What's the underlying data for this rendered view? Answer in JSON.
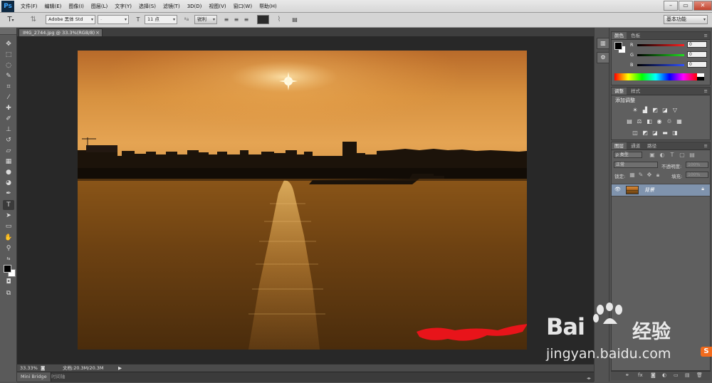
{
  "app": {
    "logo": "Ps"
  },
  "menu": [
    "文件(F)",
    "编辑(E)",
    "图像(I)",
    "图层(L)",
    "文字(Y)",
    "选择(S)",
    "滤镜(T)",
    "3D(D)",
    "视图(V)",
    "窗口(W)",
    "帮助(H)"
  ],
  "window_controls": {
    "minimize": "–",
    "restore": "▭",
    "close": "✕"
  },
  "options": {
    "font_family": "Adobe 黑体 Std",
    "font_style": "-",
    "font_size": "11 点",
    "antialias": "锐利",
    "workspace": "基本功能"
  },
  "document": {
    "tab_title": "IMG_2744.jpg @ 33.3%(RGB/8)",
    "zoom": "33.33%",
    "doc_size": "文档:20.3M/20.3M"
  },
  "bottom_tabs": {
    "mini_bridge": "Mini Bridge",
    "timeline": "时间轴"
  },
  "color_panel": {
    "tabs": [
      "颜色",
      "色板"
    ],
    "channels": [
      {
        "label": "R",
        "value": "0",
        "gradient_color": "#ff2020"
      },
      {
        "label": "G",
        "value": "0",
        "gradient_color": "#20e020"
      },
      {
        "label": "B",
        "value": "0",
        "gradient_color": "#3050ff"
      }
    ]
  },
  "adjustments_panel": {
    "tabs": [
      "调整",
      "样式"
    ],
    "heading": "添加调整"
  },
  "layers_panel": {
    "tabs": [
      "图层",
      "通道",
      "路径"
    ],
    "filter_kind": "ρ 类型",
    "blend_mode": "正常",
    "opacity_label": "不透明度:",
    "opacity_value": "100%",
    "lock_label": "锁定:",
    "fill_label": "填充:",
    "fill_value": "100%",
    "layers": [
      {
        "name": "背景",
        "visible": true,
        "locked": true
      }
    ]
  },
  "watermark": {
    "brand": "Bai",
    "brand_suffix": "经验",
    "url": "jingyan.baidu.com",
    "corner_badge": "S"
  },
  "colors": {
    "accent": "#3ea6ff",
    "selected_layer": "#7f93ad",
    "canvas_bg": "#282828"
  }
}
